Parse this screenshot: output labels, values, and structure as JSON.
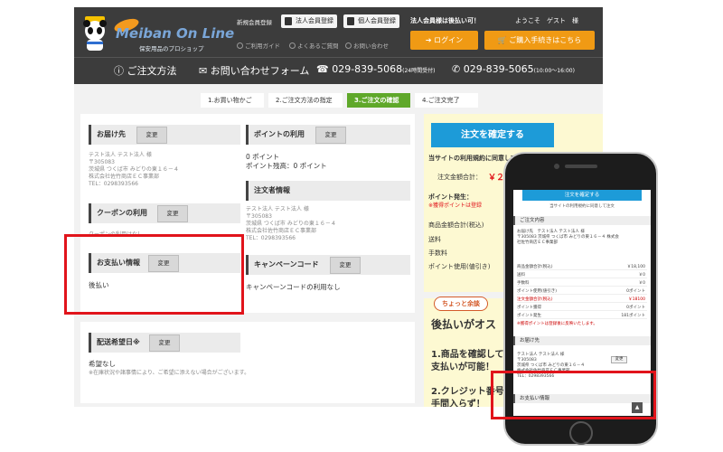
{
  "header": {
    "brand": "Meiban On Line",
    "brand_sub": "保安用品のプロショップ",
    "new_member": "新規会員登録",
    "corp_register": "法人会員登録",
    "individual_register": "個人会員登録",
    "notice": "法人会員様は後払い可！",
    "welcome": "ようこそ　ゲスト　様",
    "guide": "ご利用ガイド",
    "faq": "よくあるご質問",
    "contact": "お問い合わせ",
    "login": "ログイン",
    "checkout": "ご購入手続きはこちら",
    "order_method": "ご注文方法",
    "contact_form": "お問い合わせフォーム",
    "tel": "029-839-5068",
    "tel_hours": "(24時間受付)",
    "fax": "029-839-5065",
    "fax_hours": "(10:00～16:00)"
  },
  "steps": [
    "1.お買い物かご",
    "2.ご注文方法の指定",
    "3.ご注文の確認",
    "4.ご注文完了"
  ],
  "left": {
    "delivery_title": "お届け先",
    "change": "変更",
    "delivery_lines": [
      "テスト法人 テスト法人 様",
      "〒305083",
      "茨城県 つくば市 みどりの東１６－４",
      "株式会社佐竹商店ＥＣ事業部",
      "TEL：0298393566"
    ],
    "coupon_title": "クーポンの利用",
    "coupon_text": "クーポンの利用はなし",
    "payment_title": "お支払い情報",
    "payment_value": "後払い",
    "delivery_date_title": "配送希望日※",
    "delivery_date_value": "希望なし",
    "delivery_date_note": "※在庫状況や諸事情により、ご希望に添えない場合がございます。"
  },
  "middle": {
    "points_title": "ポイントの利用",
    "points_value": "0 ポイント",
    "points_balance": "ポイント残高：0 ポイント",
    "orderer_title": "注文者情報",
    "orderer_lines": [
      "テスト法人 テスト法人 様",
      "〒305083",
      "茨城県 つくば市 みどりの東１６－４",
      "株式会社佐竹商店ＥＣ事業部",
      "TEL：0298393566"
    ],
    "campaign_title": "キャンペーンコード",
    "campaign_text": "キャンペーンコードの利用なし"
  },
  "right": {
    "confirm": "注文を確定する",
    "terms": "当サイトの利用規約に同意して",
    "total_label": "注文金額合計：",
    "total_value": "￥２",
    "points_gain": "ポイント発生：",
    "points_warn": "※獲得ポイントは登録",
    "subtotal": "商品金額合計(税込)",
    "shipping": "送料",
    "fee": "手数料",
    "points_used": "ポイント使用(値引き)",
    "promo_badge": "ちょっと余談",
    "promo_title": "後払いがオス",
    "promo_1": "1.商品を確認して",
    "promo_1b": "支払いが可能！",
    "promo_2": "2.クレジット番号",
    "promo_2b": "手間入らず！"
  },
  "mobile": {
    "confirm": "注文を確定する",
    "note": "当サイトの利用規約に同意して注文",
    "order_title": "ご注文内容",
    "order_lines": [
      "お届け先　テスト法人 テスト法人 様",
      "〒305083 茨城県 つくば市 みどりの東１６－４ 株式会",
      "社佐竹商店ＥＣ事業部"
    ],
    "rows": [
      {
        "label": "商品金額合計(税込)",
        "value": "￥18,100",
        "red": false
      },
      {
        "label": "送料",
        "value": "￥0",
        "red": false
      },
      {
        "label": "手数料",
        "value": "￥0",
        "red": false
      },
      {
        "label": "ポイント使用(値引き)",
        "value": "0ポイント",
        "red": false
      },
      {
        "label": "注文金額合計(税込)",
        "value": "￥18100",
        "red": true
      },
      {
        "label": "ポイント獲得",
        "value": "0ポイント",
        "red": false
      },
      {
        "label": "ポイント発生",
        "value": "181ポイント",
        "red": false
      }
    ],
    "points_note": "※獲得ポイントは登録後に反映いたします。",
    "delivery_title": "お届け先",
    "delivery_lines": [
      "テスト法人 テスト法人 様",
      "〒305083",
      "茨城県 つくば市 みどりの東１６－４",
      "株式会社佐竹商店ＥＣ事業部",
      "TEL：0298393566"
    ],
    "change": "変更",
    "payment_title": "お支払い情報",
    "up": "▲"
  },
  "colors": {
    "accent": "#1d9bd8",
    "highlight": "#e1141b",
    "step_active": "#5fa82a",
    "orange": "#f09a14"
  }
}
